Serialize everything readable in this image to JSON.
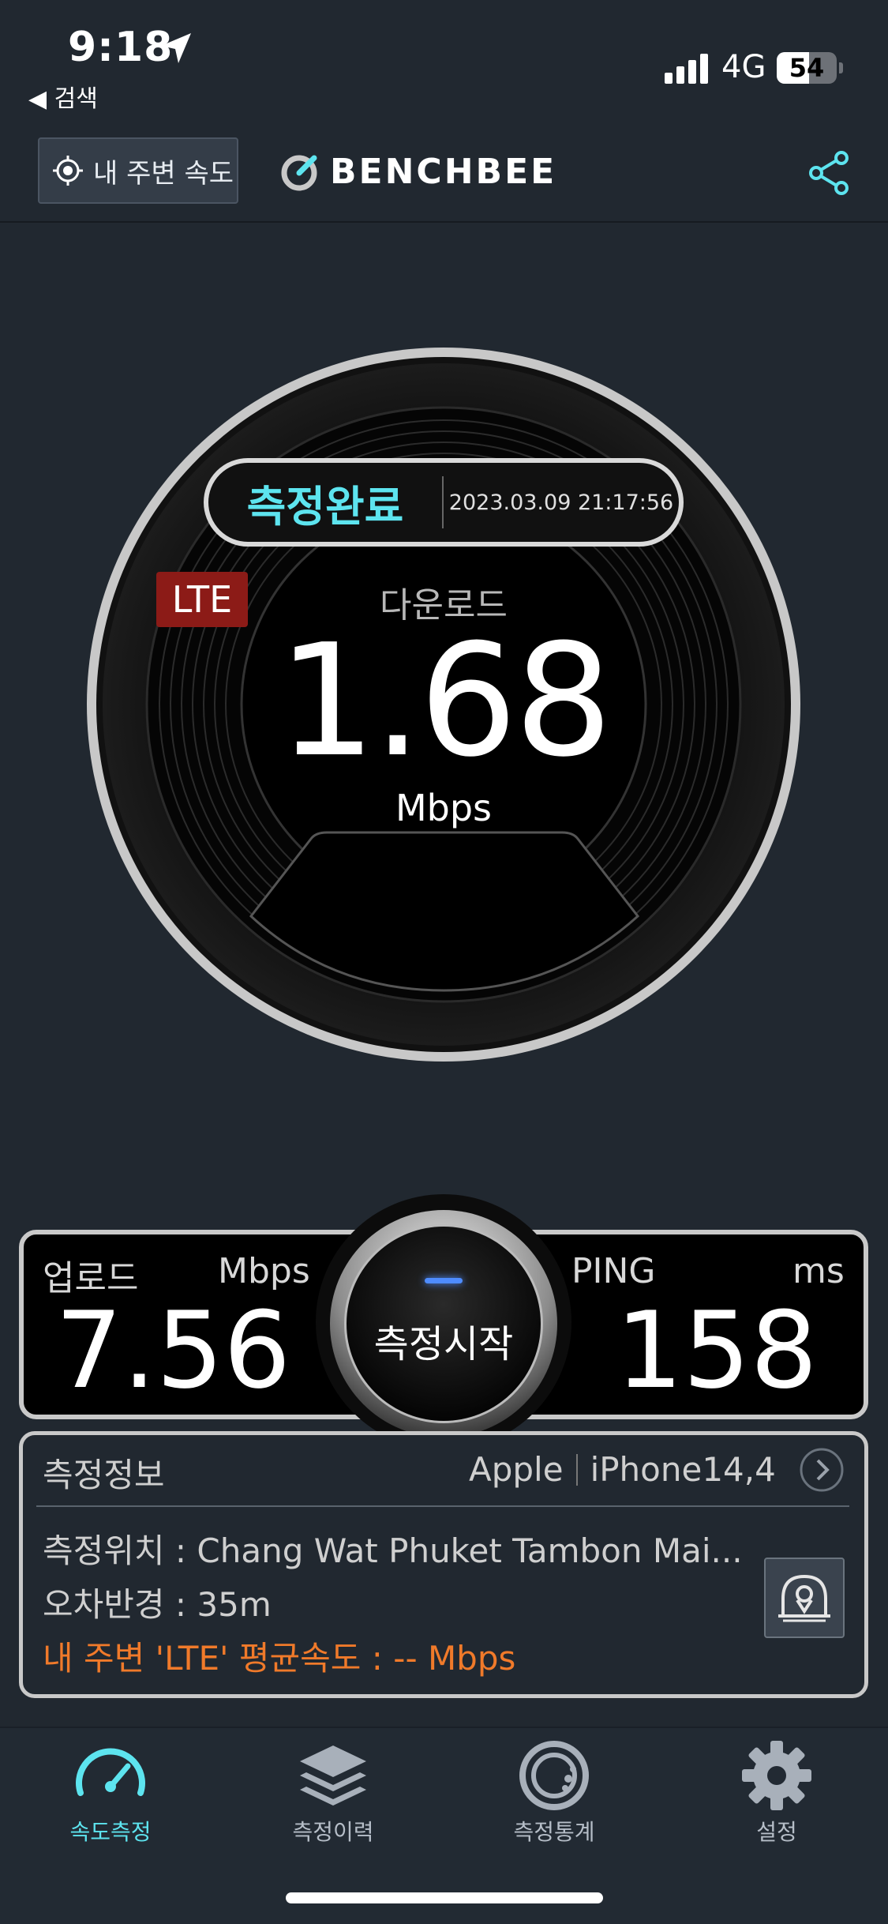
{
  "status_bar": {
    "time": "9:18",
    "back_label": "◀ 검색",
    "network": "4G",
    "battery": 54
  },
  "header": {
    "nearby_label": "내 주변 속도",
    "logo": "BENCHBEE"
  },
  "gauge": {
    "status": "측정완료",
    "timestamp": "2023.03.09 21:17:56",
    "network_badge": "LTE",
    "download_label": "다운로드",
    "download_value": "1.68",
    "download_unit": "Mbps"
  },
  "results": {
    "upload_label": "업로드",
    "upload_unit": "Mbps",
    "upload_value": "7.56",
    "start_label": "측정시작",
    "ping_label": "PING",
    "ping_unit": "ms",
    "ping_value": "158"
  },
  "info": {
    "title": "측정정보",
    "maker": "Apple",
    "model": "iPhone14,4",
    "location": "측정위치 : Chang Wat Phuket Tambon Mai...",
    "error_radius": "오차반경 : 35m",
    "avg_speed": "내 주변 'LTE' 평균속도 : -- Mbps"
  },
  "tabs": [
    {
      "label": "속도측정",
      "icon": "speedometer-icon",
      "active": true
    },
    {
      "label": "측정이력",
      "icon": "layers-icon",
      "active": false
    },
    {
      "label": "측정통계",
      "icon": "stats-disc-icon",
      "active": false
    },
    {
      "label": "설정",
      "icon": "gear-icon",
      "active": false
    }
  ],
  "colors": {
    "accent": "#5de4ef",
    "warning": "#f07a2a",
    "badge": "#8c1b17",
    "background": "#212830"
  }
}
